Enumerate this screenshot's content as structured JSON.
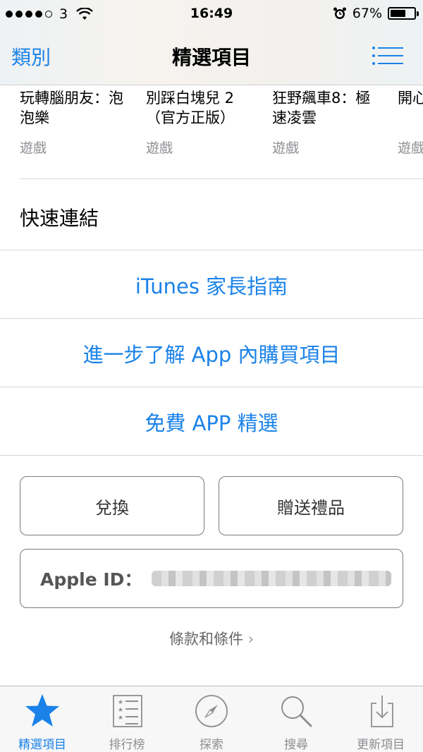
{
  "status_bar": {
    "carrier": "3",
    "time": "16:49",
    "battery": "67%",
    "battery_level": 0.67,
    "signal_bars": 4
  },
  "nav": {
    "back_label": "類別",
    "title": "精選項目",
    "menu_icon": "list-icon"
  },
  "apps": [
    {
      "name": "玩轉腦朋友：泡泡樂",
      "category": "遊戲"
    },
    {
      "name": "別踩白塊兒 2（官方正版）",
      "category": "遊戲"
    },
    {
      "name": "狂野飆車8：極速凌雲",
      "category": "遊戲"
    },
    {
      "name": "開心",
      "category": "遊戲"
    }
  ],
  "quick_links": {
    "heading": "快速連結",
    "items": [
      "iTunes 家長指南",
      "進一步了解 App 內購買項目",
      "免費 APP 精選"
    ]
  },
  "actions": {
    "redeem": "兌換",
    "gift": "贈送禮品"
  },
  "apple_id": {
    "label": "Apple ID："
  },
  "terms": "條款和條件",
  "terms_chevron": "›",
  "tabs": [
    {
      "label": "精選項目",
      "icon": "star-icon",
      "active": true
    },
    {
      "label": "排行榜",
      "icon": "top-charts-icon",
      "active": false
    },
    {
      "label": "探索",
      "icon": "compass-icon",
      "active": false
    },
    {
      "label": "搜尋",
      "icon": "search-icon",
      "active": false
    },
    {
      "label": "更新項目",
      "icon": "download-icon",
      "active": false
    }
  ],
  "colors": {
    "accent": "#1a82e8",
    "inactive": "#8e8e93"
  }
}
